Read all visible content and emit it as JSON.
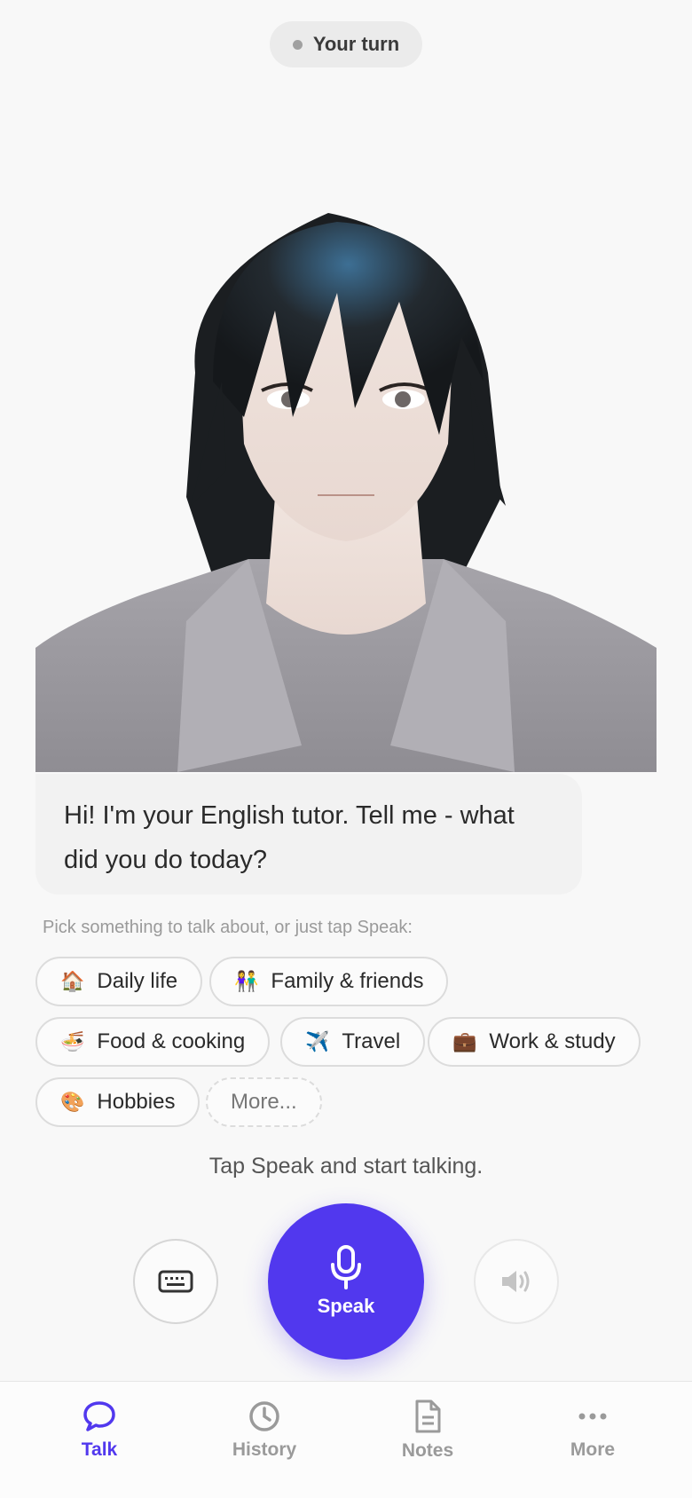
{
  "status": {
    "label": "Your turn"
  },
  "tutor": {
    "message": "Hi! I'm your English tutor. Tell me - what did you do today?"
  },
  "topics": {
    "hint": "Pick something to talk about, or just tap Speak:",
    "chips": [
      {
        "emoji": "🏠",
        "label": "Daily life"
      },
      {
        "emoji": "👫",
        "label": "Family & friends"
      },
      {
        "emoji": "🍜",
        "label": "Food & cooking"
      },
      {
        "emoji": "✈️",
        "label": "Travel"
      },
      {
        "emoji": "💼",
        "label": "Work & study"
      },
      {
        "emoji": "🎨",
        "label": "Hobbies"
      }
    ],
    "more_label": "More..."
  },
  "controls": {
    "hint": "Tap Speak and start talking.",
    "speak_label": "Speak",
    "keyboard_icon": "keyboard-icon",
    "speaker_icon": "speaker-icon",
    "mic_icon": "microphone-icon"
  },
  "tabs": [
    {
      "label": "Talk",
      "icon": "chat-bubble-icon",
      "active": true
    },
    {
      "label": "History",
      "icon": "clock-icon",
      "active": false
    },
    {
      "label": "Notes",
      "icon": "document-icon",
      "active": false
    },
    {
      "label": "More",
      "icon": "more-dots-icon",
      "active": false
    }
  ],
  "colors": {
    "accent": "#5138ee",
    "background": "#f8f8f8",
    "bubble": "#f2f2f2",
    "inactive": "#9a9a9a"
  }
}
